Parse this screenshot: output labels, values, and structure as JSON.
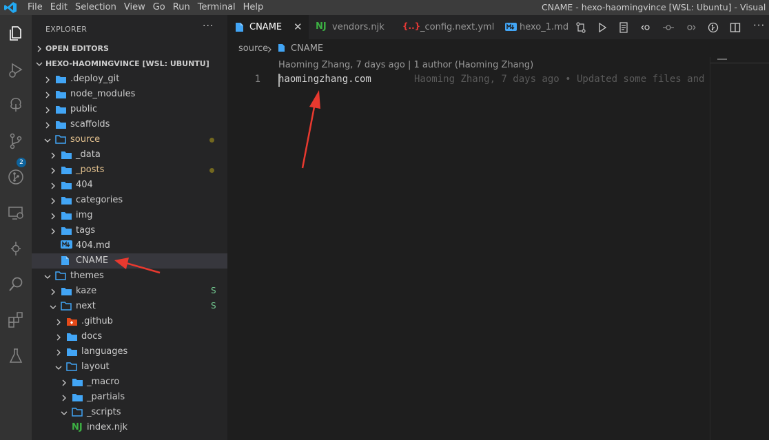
{
  "menu": [
    "File",
    "Edit",
    "Selection",
    "View",
    "Go",
    "Run",
    "Terminal",
    "Help"
  ],
  "window_title": "CNAME - hexo-haomingvince [WSL: Ubuntu] - Visual Studio Code",
  "activity_bar": {
    "icons": [
      "explorer-icon",
      "run-debug-icon",
      "remote-tree-icon",
      "source-control-icon",
      "git-graph-icon",
      "remote-explorer-icon",
      "timeline-icon",
      "search-icon",
      "extensions-icon",
      "testing-icon"
    ],
    "scm_badge": "2"
  },
  "sidebar": {
    "title": "EXPLORER",
    "more": "···",
    "open_editors": "OPEN EDITORS",
    "workspace": "HEXO-HAOMINGVINCE [WSL: UBUNTU]",
    "tree": [
      {
        "name": ".deploy_git",
        "type": "folder"
      },
      {
        "name": "node_modules",
        "type": "folder"
      },
      {
        "name": "public",
        "type": "folder"
      },
      {
        "name": "scaffolds",
        "type": "folder"
      },
      {
        "name": "source",
        "type": "folder-open",
        "modified": true
      },
      {
        "name": "_data",
        "type": "folder"
      },
      {
        "name": "_posts",
        "type": "folder",
        "modified": true
      },
      {
        "name": "404",
        "type": "folder"
      },
      {
        "name": "categories",
        "type": "folder"
      },
      {
        "name": "img",
        "type": "folder"
      },
      {
        "name": "tags",
        "type": "folder"
      },
      {
        "name": "404.md",
        "type": "markdown"
      },
      {
        "name": "CNAME",
        "type": "file",
        "selected": true
      },
      {
        "name": "themes",
        "type": "folder-open"
      },
      {
        "name": "kaze",
        "type": "folder",
        "status": "S"
      },
      {
        "name": "next",
        "type": "folder-open",
        "status": "S"
      },
      {
        "name": ".github",
        "type": "folder-github"
      },
      {
        "name": "docs",
        "type": "folder"
      },
      {
        "name": "languages",
        "type": "folder"
      },
      {
        "name": "layout",
        "type": "folder-open"
      },
      {
        "name": "_macro",
        "type": "folder"
      },
      {
        "name": "_partials",
        "type": "folder"
      },
      {
        "name": "_scripts",
        "type": "folder-open"
      },
      {
        "name": "index.njk",
        "type": "nunjucks"
      }
    ]
  },
  "tabs": [
    {
      "label": "CNAME",
      "icon": "file-icon",
      "active": true
    },
    {
      "label": "vendors.njk",
      "icon": "nunjucks-icon"
    },
    {
      "label": "_config.next.yml",
      "icon": "yaml-icon"
    },
    {
      "label": "hexo_1.md",
      "icon": "markdown-icon"
    }
  ],
  "breadcrumb": {
    "folder": "source",
    "file": "CNAME"
  },
  "editor": {
    "codelens": "Haoming Zhang, 7 days ago | 1 author (Haoming Zhang)",
    "line_number": "1",
    "line_text": "haomingzhang.com",
    "blame": "Haoming Zhang, 7 days ago • Updated some files and"
  },
  "colors": {
    "accent": "#007acc",
    "annotation_arrow": "#e8392f",
    "modified": "#e2c08d",
    "folder": "#42a5f5"
  }
}
